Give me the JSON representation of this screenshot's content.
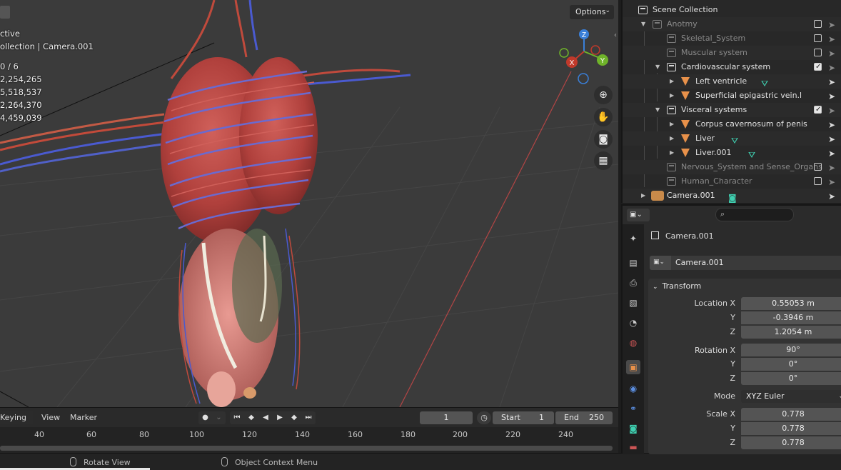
{
  "viewport": {
    "stats": [
      "ctive",
      "ollection | Camera.001",
      "0 / 6",
      "2,254,265",
      "5,518,537",
      "2,264,370",
      "4,459,039"
    ],
    "options_label": "Options",
    "gizmo": {
      "z": "Z",
      "y": "Y",
      "x": "X"
    }
  },
  "timeline": {
    "keying_label": "Keying",
    "view_label": "View",
    "marker_label": "Marker",
    "current_frame": "1",
    "start_label": "Start",
    "start_value": "1",
    "end_label": "End",
    "end_value": "250",
    "ticks": [
      "40",
      "60",
      "80",
      "100",
      "120",
      "140",
      "160",
      "180",
      "200",
      "220",
      "240"
    ]
  },
  "statusbar": {
    "rotate_view": "Rotate View",
    "context_menu": "Object Context Menu"
  },
  "outliner": {
    "rows": [
      {
        "label": "Scene Collection",
        "type": "scene"
      },
      {
        "label": "Anotmy",
        "type": "collection",
        "dim": true
      },
      {
        "label": "Skeletal_System",
        "type": "collection",
        "dim": true
      },
      {
        "label": "Muscular system",
        "type": "collection",
        "dim": true
      },
      {
        "label": "Cardiovascular system",
        "type": "collection",
        "checked": true
      },
      {
        "label": "Left ventricle",
        "type": "mesh"
      },
      {
        "label": "Superficial epigastric vein.l",
        "type": "mesh"
      },
      {
        "label": "Visceral systems",
        "type": "collection",
        "checked": true
      },
      {
        "label": "Corpus cavernosum of penis",
        "type": "mesh"
      },
      {
        "label": "Liver",
        "type": "mesh"
      },
      {
        "label": "Liver.001",
        "type": "mesh"
      },
      {
        "label": "Nervous_System and Sense_Organs",
        "type": "collection",
        "dim": true
      },
      {
        "label": "Human_Character",
        "type": "collection",
        "dim": true
      },
      {
        "label": "Camera.001",
        "type": "camera"
      }
    ]
  },
  "properties": {
    "object_name": "Camera.001",
    "datablock_name": "Camera.001",
    "transform_title": "Transform",
    "location": {
      "label": "Location X",
      "x": "0.55053 m",
      "y": "-0.3946 m",
      "z": "1.2054 m"
    },
    "rotation": {
      "label": "Rotation X",
      "x": "90°",
      "y": "0°",
      "z": "0°"
    },
    "mode": {
      "label": "Mode",
      "value": "XYZ Euler"
    },
    "scale": {
      "label": "Scale X",
      "x": "0.778",
      "y": "0.778",
      "z": "0.778"
    },
    "axis_y": "Y",
    "axis_z": "Z"
  },
  "colors": {
    "viewport_bg": "#3b3b3b",
    "organ_red": "#b8403c",
    "vein_blue": "#4a5ad0",
    "axis_red": "#c0392b",
    "axis_green": "#6fb32a",
    "axis_blue": "#3a7fd8",
    "mesh_orange": "#e8914a",
    "vertex_group_teal": "#3fcfb0"
  }
}
